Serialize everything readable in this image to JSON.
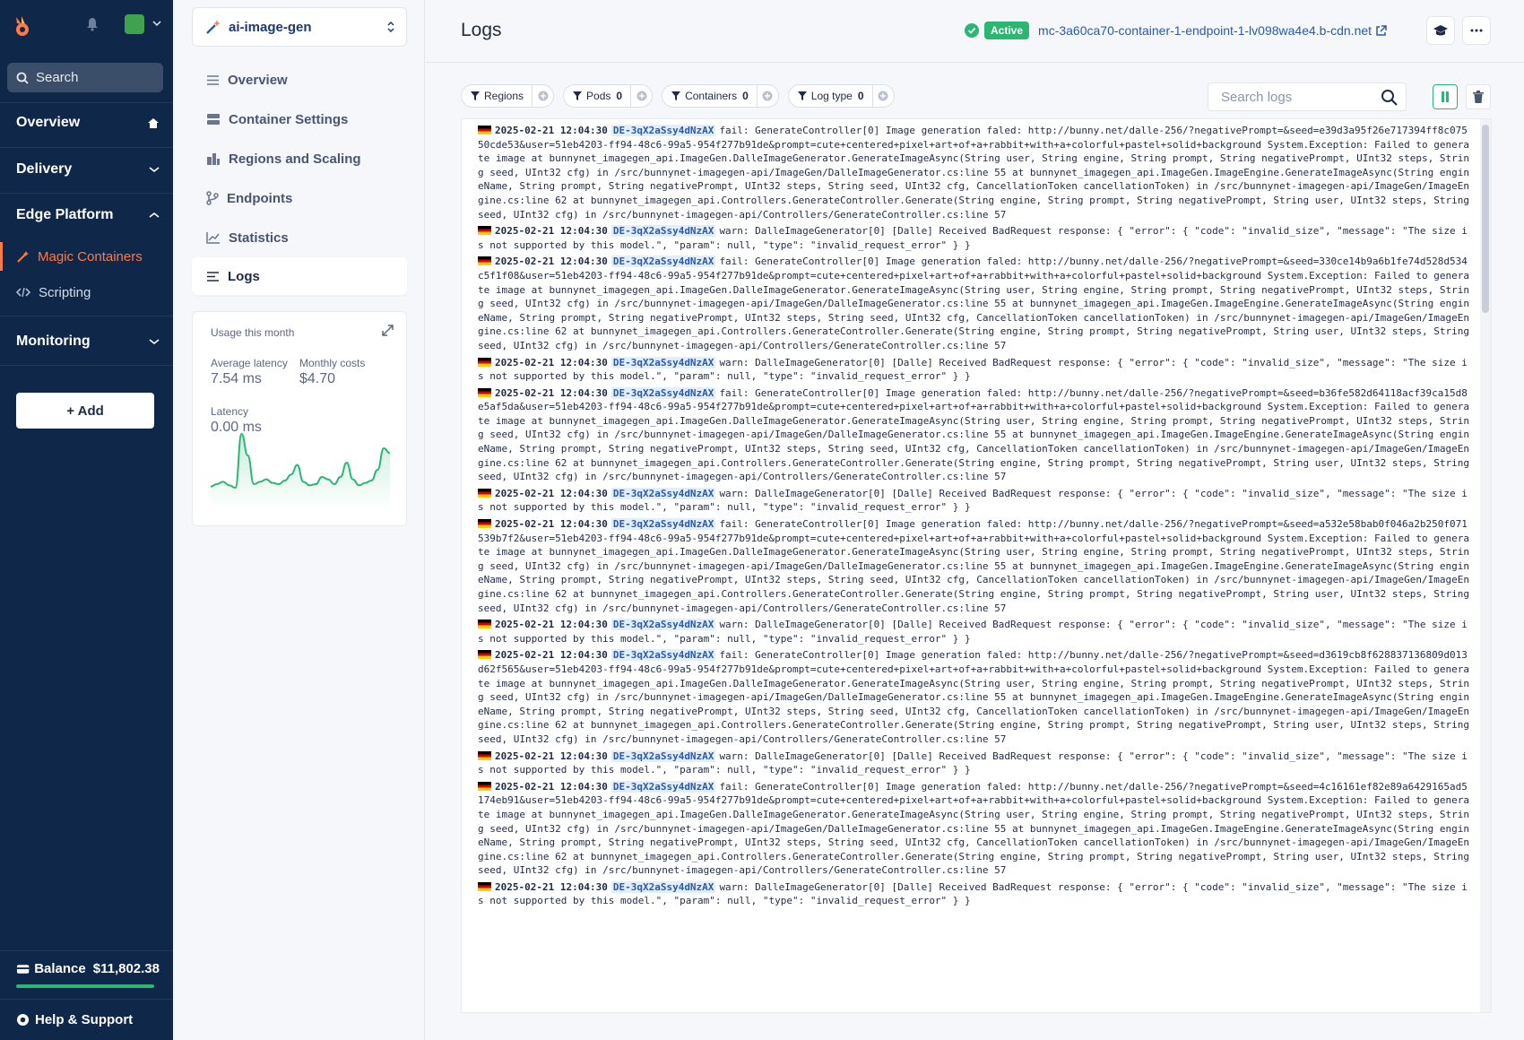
{
  "nav": {
    "search_placeholder": "Search",
    "sections": {
      "overview": "Overview",
      "delivery": "Delivery",
      "edge_platform": "Edge Platform",
      "monitoring": "Monitoring"
    },
    "edge_items": [
      "Magic Containers",
      "Scripting"
    ],
    "add_label": "+ Add",
    "balance_label": "Balance",
    "balance_amount": "$11,802.38",
    "help_label": "Help & Support"
  },
  "app": {
    "name": "ai-image-gen",
    "menu": [
      "Overview",
      "Container Settings",
      "Regions and Scaling",
      "Endpoints",
      "Statistics",
      "Logs"
    ],
    "active_menu": "Logs"
  },
  "usage": {
    "title": "Usage this month",
    "avg_latency_label": "Average latency",
    "avg_latency_value": "7.54 ms",
    "monthly_costs_label": "Monthly costs",
    "monthly_costs_value": "$4.70",
    "latency_label": "Latency",
    "latency_value": "0.00 ms",
    "sparkline": [
      4,
      6,
      8,
      5,
      3,
      48,
      30,
      6,
      8,
      10,
      7,
      6,
      9,
      14,
      22,
      8,
      5,
      6,
      12,
      10,
      6,
      12,
      24,
      10,
      5,
      7,
      9,
      18,
      36,
      32
    ]
  },
  "header": {
    "title": "Logs",
    "status": "Active",
    "endpoint": "mc-3a60ca70-container-1-endpoint-1-lv098wa4e4.b-cdn.net"
  },
  "filters": [
    {
      "label": "Regions",
      "count": ""
    },
    {
      "label": "Pods",
      "count": "0"
    },
    {
      "label": "Containers",
      "count": "0"
    },
    {
      "label": "Log type",
      "count": "0"
    }
  ],
  "log_search_placeholder": "Search logs",
  "colors": {
    "accent": "#ff7a4a",
    "success": "#2bb673",
    "nav_bg": "#0f2748"
  },
  "logs": [
    {
      "ts": "2025-02-21 12:04:30",
      "pod": "DE-3qX2aSsy4dNzAX",
      "msg": "fail: GenerateController[0] Image generation faled: http://bunny.net/dalle-256/?negativePrompt=&seed=e39d3a95f26e717394ff8c07550cde53&user=51eb4203-ff94-48c6-99a5-954f277b91de&prompt=cute+centered+pixel+art+of+a+rabbit+with+a+colorful+pastel+solid+background System.Exception: Failed to generate image at bunnynet_imagegen_api.ImageGen.DalleImageGenerator.GenerateImageAsync(String user, String engine, String prompt, String negativePrompt, UInt32 steps, String seed, UInt32 cfg) in /src/bunnynet-imagegen-api/ImageGen/DalleImageGenerator.cs:line 55 at bunnynet_imagegen_api.ImageGen.ImageEngine.GenerateImageAsync(String engineName, String prompt, String negativePrompt, UInt32 steps, String seed, UInt32 cfg, CancellationToken cancellationToken) in /src/bunnynet-imagegen-api/ImageGen/ImageEngine.cs:line 62 at bunnynet_imagegen_api.Controllers.GenerateController.Generate(String engine, String prompt, String negativePrompt, String user, UInt32 steps, String seed, UInt32 cfg) in /src/bunnynet-imagegen-api/Controllers/GenerateController.cs:line 57"
    },
    {
      "ts": "2025-02-21 12:04:30",
      "pod": "DE-3qX2aSsy4dNzAX",
      "msg": "warn: DalleImageGenerator[0] [Dalle] Received BadRequest response: { \"error\": { \"code\": \"invalid_size\", \"message\": \"The size is not supported by this model.\", \"param\": null, \"type\": \"invalid_request_error\" } }"
    },
    {
      "ts": "2025-02-21 12:04:30",
      "pod": "DE-3qX2aSsy4dNzAX",
      "msg": "fail: GenerateController[0] Image generation faled: http://bunny.net/dalle-256/?negativePrompt=&seed=330ce14b9a6b1fe74d528d534c5f1f08&user=51eb4203-ff94-48c6-99a5-954f277b91de&prompt=cute+centered+pixel+art+of+a+rabbit+with+a+colorful+pastel+solid+background System.Exception: Failed to generate image at bunnynet_imagegen_api.ImageGen.DalleImageGenerator.GenerateImageAsync(String user, String engine, String prompt, String negativePrompt, UInt32 steps, String seed, UInt32 cfg) in /src/bunnynet-imagegen-api/ImageGen/DalleImageGenerator.cs:line 55 at bunnynet_imagegen_api.ImageGen.ImageEngine.GenerateImageAsync(String engineName, String prompt, String negativePrompt, UInt32 steps, String seed, UInt32 cfg, CancellationToken cancellationToken) in /src/bunnynet-imagegen-api/ImageGen/ImageEngine.cs:line 62 at bunnynet_imagegen_api.Controllers.GenerateController.Generate(String engine, String prompt, String negativePrompt, String user, UInt32 steps, String seed, UInt32 cfg) in /src/bunnynet-imagegen-api/Controllers/GenerateController.cs:line 57"
    },
    {
      "ts": "2025-02-21 12:04:30",
      "pod": "DE-3qX2aSsy4dNzAX",
      "msg": "warn: DalleImageGenerator[0] [Dalle] Received BadRequest response: { \"error\": { \"code\": \"invalid_size\", \"message\": \"The size is not supported by this model.\", \"param\": null, \"type\": \"invalid_request_error\" } }"
    },
    {
      "ts": "2025-02-21 12:04:30",
      "pod": "DE-3qX2aSsy4dNzAX",
      "msg": "fail: GenerateController[0] Image generation faled: http://bunny.net/dalle-256/?negativePrompt=&seed=b36fe582d64118acf39ca15d8e5af5da&user=51eb4203-ff94-48c6-99a5-954f277b91de&prompt=cute+centered+pixel+art+of+a+rabbit+with+a+colorful+pastel+solid+background System.Exception: Failed to generate image at bunnynet_imagegen_api.ImageGen.DalleImageGenerator.GenerateImageAsync(String user, String engine, String prompt, String negativePrompt, UInt32 steps, String seed, UInt32 cfg) in /src/bunnynet-imagegen-api/ImageGen/DalleImageGenerator.cs:line 55 at bunnynet_imagegen_api.ImageGen.ImageEngine.GenerateImageAsync(String engineName, String prompt, String negativePrompt, UInt32 steps, String seed, UInt32 cfg, CancellationToken cancellationToken) in /src/bunnynet-imagegen-api/ImageGen/ImageEngine.cs:line 62 at bunnynet_imagegen_api.Controllers.GenerateController.Generate(String engine, String prompt, String negativePrompt, String user, UInt32 steps, String seed, UInt32 cfg) in /src/bunnynet-imagegen-api/Controllers/GenerateController.cs:line 57"
    },
    {
      "ts": "2025-02-21 12:04:30",
      "pod": "DE-3qX2aSsy4dNzAX",
      "msg": "warn: DalleImageGenerator[0] [Dalle] Received BadRequest response: { \"error\": { \"code\": \"invalid_size\", \"message\": \"The size is not supported by this model.\", \"param\": null, \"type\": \"invalid_request_error\" } }"
    },
    {
      "ts": "2025-02-21 12:04:30",
      "pod": "DE-3qX2aSsy4dNzAX",
      "msg": "fail: GenerateController[0] Image generation faled: http://bunny.net/dalle-256/?negativePrompt=&seed=a532e58bab0f046a2b250f071539b7f2&user=51eb4203-ff94-48c6-99a5-954f277b91de&prompt=cute+centered+pixel+art+of+a+rabbit+with+a+colorful+pastel+solid+background System.Exception: Failed to generate image at bunnynet_imagegen_api.ImageGen.DalleImageGenerator.GenerateImageAsync(String user, String engine, String prompt, String negativePrompt, UInt32 steps, String seed, UInt32 cfg) in /src/bunnynet-imagegen-api/ImageGen/DalleImageGenerator.cs:line 55 at bunnynet_imagegen_api.ImageGen.ImageEngine.GenerateImageAsync(String engineName, String prompt, String negativePrompt, UInt32 steps, String seed, UInt32 cfg, CancellationToken cancellationToken) in /src/bunnynet-imagegen-api/ImageGen/ImageEngine.cs:line 62 at bunnynet_imagegen_api.Controllers.GenerateController.Generate(String engine, String prompt, String negativePrompt, String user, UInt32 steps, String seed, UInt32 cfg) in /src/bunnynet-imagegen-api/Controllers/GenerateController.cs:line 57"
    },
    {
      "ts": "2025-02-21 12:04:30",
      "pod": "DE-3qX2aSsy4dNzAX",
      "msg": "warn: DalleImageGenerator[0] [Dalle] Received BadRequest response: { \"error\": { \"code\": \"invalid_size\", \"message\": \"The size is not supported by this model.\", \"param\": null, \"type\": \"invalid_request_error\" } }"
    },
    {
      "ts": "2025-02-21 12:04:30",
      "pod": "DE-3qX2aSsy4dNzAX",
      "msg": "fail: GenerateController[0] Image generation faled: http://bunny.net/dalle-256/?negativePrompt=&seed=d3619cb8f628837136809d013d62f565&user=51eb4203-ff94-48c6-99a5-954f277b91de&prompt=cute+centered+pixel+art+of+a+rabbit+with+a+colorful+pastel+solid+background System.Exception: Failed to generate image at bunnynet_imagegen_api.ImageGen.DalleImageGenerator.GenerateImageAsync(String user, String engine, String prompt, String negativePrompt, UInt32 steps, String seed, UInt32 cfg) in /src/bunnynet-imagegen-api/ImageGen/DalleImageGenerator.cs:line 55 at bunnynet_imagegen_api.ImageGen.ImageEngine.GenerateImageAsync(String engineName, String prompt, String negativePrompt, UInt32 steps, String seed, UInt32 cfg, CancellationToken cancellationToken) in /src/bunnynet-imagegen-api/ImageGen/ImageEngine.cs:line 62 at bunnynet_imagegen_api.Controllers.GenerateController.Generate(String engine, String prompt, String negativePrompt, String user, UInt32 steps, String seed, UInt32 cfg) in /src/bunnynet-imagegen-api/Controllers/GenerateController.cs:line 57"
    },
    {
      "ts": "2025-02-21 12:04:30",
      "pod": "DE-3qX2aSsy4dNzAX",
      "msg": "warn: DalleImageGenerator[0] [Dalle] Received BadRequest response: { \"error\": { \"code\": \"invalid_size\", \"message\": \"The size is not supported by this model.\", \"param\": null, \"type\": \"invalid_request_error\" } }"
    },
    {
      "ts": "2025-02-21 12:04:30",
      "pod": "DE-3qX2aSsy4dNzAX",
      "msg": "fail: GenerateController[0] Image generation faled: http://bunny.net/dalle-256/?negativePrompt=&seed=4c16161ef82e89a6429165ad5174eb91&user=51eb4203-ff94-48c6-99a5-954f277b91de&prompt=cute+centered+pixel+art+of+a+rabbit+with+a+colorful+pastel+solid+background System.Exception: Failed to generate image at bunnynet_imagegen_api.ImageGen.DalleImageGenerator.GenerateImageAsync(String user, String engine, String prompt, String negativePrompt, UInt32 steps, String seed, UInt32 cfg) in /src/bunnynet-imagegen-api/ImageGen/DalleImageGenerator.cs:line 55 at bunnynet_imagegen_api.ImageGen.ImageEngine.GenerateImageAsync(String engineName, String prompt, String negativePrompt, UInt32 steps, String seed, UInt32 cfg, CancellationToken cancellationToken) in /src/bunnynet-imagegen-api/ImageGen/ImageEngine.cs:line 62 at bunnynet_imagegen_api.Controllers.GenerateController.Generate(String engine, String prompt, String negativePrompt, String user, UInt32 steps, String seed, UInt32 cfg) in /src/bunnynet-imagegen-api/Controllers/GenerateController.cs:line 57"
    },
    {
      "ts": "2025-02-21 12:04:30",
      "pod": "DE-3qX2aSsy4dNzAX",
      "msg": "warn: DalleImageGenerator[0] [Dalle] Received BadRequest response: { \"error\": { \"code\": \"invalid_size\", \"message\": \"The size is not supported by this model.\", \"param\": null, \"type\": \"invalid_request_error\" } }"
    }
  ]
}
